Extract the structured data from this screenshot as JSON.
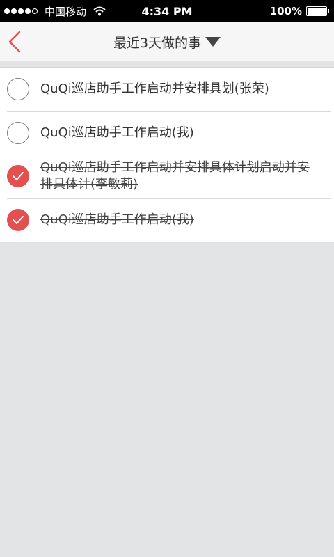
{
  "status_bar": {
    "carrier": "中国移动",
    "time": "4:34 PM",
    "battery": "100%",
    "battery_level": 1.0
  },
  "nav": {
    "title": "最近3天做的事",
    "accent_color": "#e05050"
  },
  "tasks": [
    {
      "text": "QuQi巡店助手工作启动并安排具划(张荣)",
      "completed": false
    },
    {
      "text": "QuQi巡店助手工作启动(我)",
      "completed": false
    },
    {
      "text": "QuQi巡店助手工作启动并安排具体计划启动并安排具体计(李敏莉)",
      "completed": true
    },
    {
      "text": "QuQi巡店助手工作启动(我)",
      "completed": true
    }
  ],
  "colors": {
    "check_fill": "#e25050",
    "background": "#e3e4e6"
  }
}
